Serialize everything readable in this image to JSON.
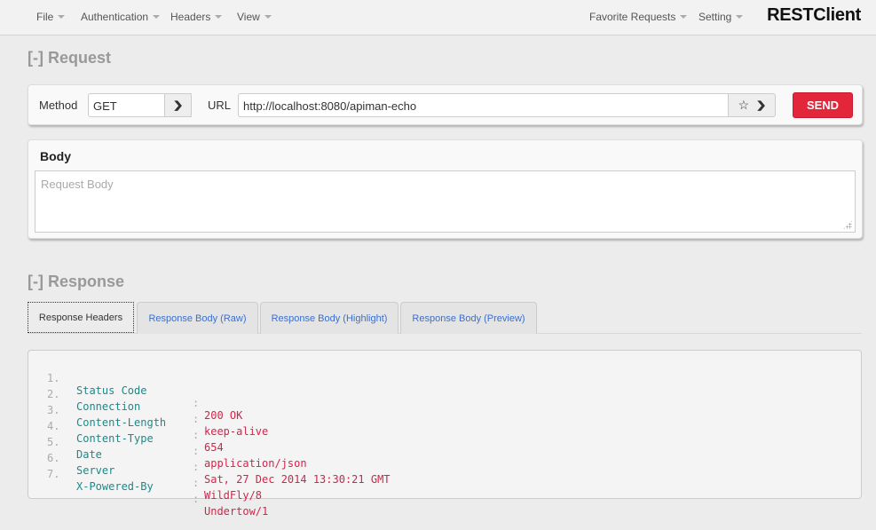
{
  "navbar": {
    "menus": [
      {
        "label": "File"
      },
      {
        "label": "Authentication"
      },
      {
        "label": "Headers"
      },
      {
        "label": "View"
      }
    ],
    "right_menus": [
      {
        "label": "Favorite Requests"
      },
      {
        "label": "Setting"
      }
    ],
    "brand": "RESTClient"
  },
  "request": {
    "section_title": "[-] Request",
    "method_label": "Method",
    "method_value": "GET",
    "url_label": "URL",
    "url_value": "http://localhost:8080/apiman-echo",
    "send_label": "SEND",
    "body_title": "Body",
    "body_placeholder": "Request Body"
  },
  "response": {
    "section_title": "[-] Response",
    "tabs": [
      {
        "label": "Response Headers",
        "active": true
      },
      {
        "label": "Response Body (Raw)",
        "active": false
      },
      {
        "label": "Response Body (Highlight)",
        "active": false
      },
      {
        "label": "Response Body (Preview)",
        "active": false
      }
    ],
    "headers": [
      {
        "num": "1.",
        "key": "Status Code",
        "value": "200 OK"
      },
      {
        "num": "2.",
        "key": "Connection",
        "value": "keep-alive"
      },
      {
        "num": "3.",
        "key": "Content-Length",
        "value": "654"
      },
      {
        "num": "4.",
        "key": "Content-Type",
        "value": "application/json"
      },
      {
        "num": "5.",
        "key": "Date",
        "value": "Sat, 27 Dec 2014 13:30:21 GMT"
      },
      {
        "num": "6.",
        "key": "Server",
        "value": "WildFly/8"
      },
      {
        "num": "7.",
        "key": "X-Powered-By",
        "value": "Undertow/1"
      }
    ],
    "separator": ":"
  },
  "colors": {
    "send": "#e3263a",
    "header_key": "#1a8a8a",
    "header_value": "#d6224a",
    "tab_link": "#3a6fcf"
  }
}
